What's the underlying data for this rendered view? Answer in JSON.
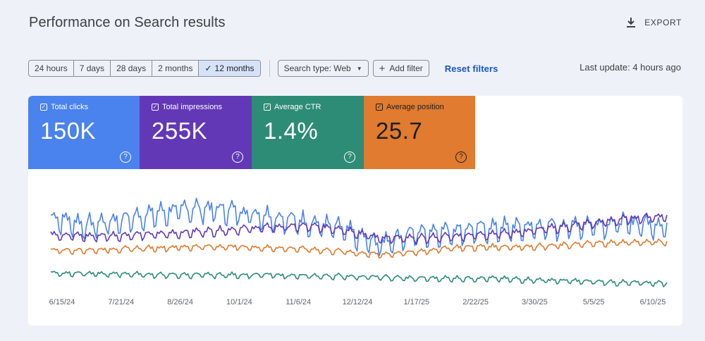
{
  "header": {
    "title": "Performance on Search results",
    "export_label": "EXPORT"
  },
  "toolbar": {
    "ranges": [
      "24 hours",
      "7 days",
      "28 days",
      "2 months",
      "12 months"
    ],
    "active_range": "12 months",
    "search_type_label": "Search type: Web",
    "add_filter_label": "Add filter",
    "reset_label": "Reset filters",
    "last_update": "Last update: 4 hours ago"
  },
  "metrics": [
    {
      "label": "Total clicks",
      "value": "150K",
      "color": "#4a82ee"
    },
    {
      "label": "Total impressions",
      "value": "255K",
      "color": "#6238b7"
    },
    {
      "label": "Average CTR",
      "value": "1.4%",
      "color": "#2d8c76"
    },
    {
      "label": "Average position",
      "value": "25.7",
      "color": "#e07b2f"
    }
  ],
  "chart_data": {
    "type": "line",
    "x_tick_labels": [
      "6/15/24",
      "7/21/24",
      "8/26/24",
      "10/1/24",
      "11/6/24",
      "12/12/24",
      "1/17/25",
      "2/22/25",
      "3/30/25",
      "5/5/25",
      "6/10/25"
    ],
    "grid": false,
    "series": [
      {
        "key": "clicks",
        "color": "#4a82ee",
        "weekly": [
          62,
          55,
          60,
          66,
          70,
          68,
          63,
          58,
          52,
          38,
          48,
          50,
          52,
          53,
          54,
          56,
          57,
          55
        ]
      },
      {
        "key": "impressions",
        "color": "#6238b7",
        "weekly": [
          48,
          46,
          47,
          48,
          50,
          52,
          54,
          55,
          53,
          45,
          44,
          46,
          48,
          50,
          54,
          58,
          62,
          64
        ]
      },
      {
        "key": "ctr",
        "color": "#2d8c76",
        "weekly": [
          14,
          13,
          13,
          12,
          12,
          12,
          12,
          11,
          11,
          10,
          9,
          9,
          9,
          8,
          7,
          6,
          5,
          5
        ]
      },
      {
        "key": "position",
        "color": "#e07b2f",
        "weekly": [
          34,
          34,
          35,
          36,
          37,
          37,
          36,
          35,
          33,
          30,
          32,
          36,
          37,
          37,
          38,
          40,
          41,
          41
        ]
      }
    ]
  }
}
